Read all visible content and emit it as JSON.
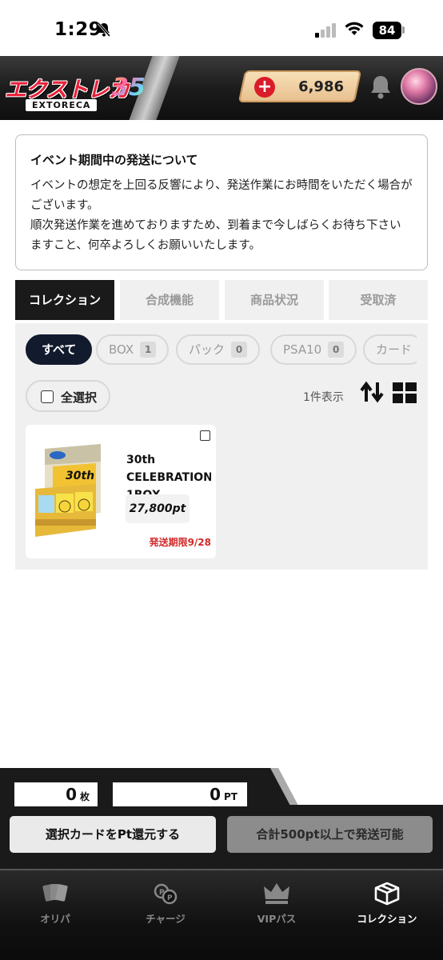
{
  "status_bar": {
    "time": "1:29",
    "battery": "84"
  },
  "header": {
    "logo_text": "エクストレカ",
    "logo_sub": "EXTORECA",
    "logo_badge": "35",
    "points": "6,986",
    "add_points_label": "+"
  },
  "notice": {
    "title": "イベント期間中の発送について",
    "body_1": "イベントの想定を上回る反響により、発送作業にお時間をいただく場合がございます。",
    "body_2": "順次発送作業を進めておりますため、到着まで今しばらくお待ち下さいますこと、何卒よろしくお願いいたします。"
  },
  "tabs": [
    {
      "label": "コレクション",
      "active": true
    },
    {
      "label": "合成機能",
      "active": false
    },
    {
      "label": "商品状況",
      "active": false
    },
    {
      "label": "受取済",
      "active": false
    }
  ],
  "filters": [
    {
      "label": "すべて",
      "count": "",
      "active": true
    },
    {
      "label": "BOX",
      "count": "1",
      "active": false
    },
    {
      "label": "パック",
      "count": "0",
      "active": false
    },
    {
      "label": "PSA10",
      "count": "0",
      "active": false
    },
    {
      "label": "カード",
      "count": "",
      "active": false
    }
  ],
  "toolbar": {
    "select_all_label": "全選択",
    "count_label": "1件表示"
  },
  "items": [
    {
      "title": "30th CELEBRATION 1BOX",
      "price": "27,800pt",
      "deadline": "発送期限9/28"
    }
  ],
  "summary": {
    "quantity": "0",
    "quantity_unit": "枚",
    "points": "0",
    "points_unit": "PT",
    "refund_button": "選択カードをPt還元する",
    "ship_button": "合計500pt以上で発送可能"
  },
  "tab_bar": [
    {
      "label": "オリパ",
      "icon": "cards-icon",
      "active": false
    },
    {
      "label": "チャージ",
      "icon": "coins-icon",
      "active": false
    },
    {
      "label": "VIPパス",
      "icon": "crown-icon",
      "active": false
    },
    {
      "label": "コレクション",
      "icon": "box-icon",
      "active": true
    }
  ],
  "colors": {
    "header_bg": "#1c1c1c",
    "active_tab": "#1a1a1a",
    "active_filter": "#121a2e",
    "deadline": "#d12a2a",
    "points_badge": "#d91c2a"
  }
}
